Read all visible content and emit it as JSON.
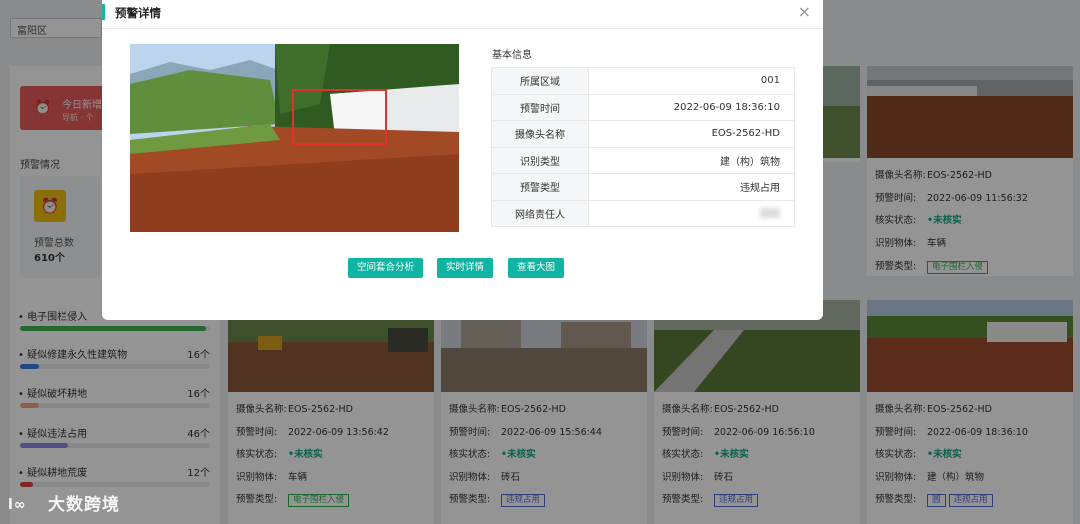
{
  "background": {
    "region_select": "富阳区",
    "today_alert": {
      "title": "今日新增",
      "sub": "导航 · 个"
    },
    "section_title": "预警情况",
    "stat": {
      "label": "预警总数",
      "value": "610个"
    },
    "categories": [
      {
        "name": "• 电子围栏侵入",
        "count": "",
        "fill": 0.98,
        "color": "#3fb44a"
      },
      {
        "name": "• 疑似修建永久性建筑物",
        "count": "16个",
        "fill": 0.1,
        "color": "#3d7be0"
      },
      {
        "name": "• 疑似破坏耕地",
        "count": "16个",
        "fill": 0.1,
        "color": "#f0a080"
      },
      {
        "name": "• 疑似违法占用",
        "count": "46个",
        "fill": 0.25,
        "color": "#8c8ce0"
      },
      {
        "name": "• 疑似耕地荒废",
        "count": "12个",
        "fill": 0.07,
        "color": "#e04040"
      }
    ],
    "top_card": {
      "cam": "EOS-2562-HD",
      "time": "2022-06-09 11:56:32",
      "status": "•未核实",
      "object": "车辆",
      "tags": [
        "电子围栏入侵"
      ]
    },
    "cards": [
      {
        "cam": "EOS-2562-HD",
        "time": "2022-06-09 13:56:42",
        "status": "•未核实",
        "object": "车辆",
        "tags": [
          "电子围栏入侵"
        ],
        "tag_style": "g"
      },
      {
        "cam": "EOS-2562-HD",
        "time": "2022-06-09 15:56:44",
        "status": "•未核实",
        "object": "砖石",
        "tags": [
          "违规占用"
        ],
        "tag_style": "b"
      },
      {
        "cam": "EOS-2562-HD",
        "time": "2022-06-09 16:56:10",
        "status": "•未核实",
        "object": "砖石",
        "tags": [
          "违规占用"
        ],
        "tag_style": "b"
      },
      {
        "cam": "EOS-2562-HD",
        "time": "2022-06-09 18:36:10",
        "status": "•未核实",
        "object": "建（构）筑物",
        "tags": [
          "圆",
          "违规占用"
        ],
        "tag_style": "b"
      }
    ],
    "labels": {
      "cam": "摄像头名称:",
      "time": "预警时间:",
      "status": "核实状态:",
      "object": "识别物体:",
      "type": "预警类型:"
    }
  },
  "modal": {
    "title": "预警详情",
    "close_glyph": "×",
    "info_title": "基本信息",
    "rows": [
      {
        "key": "所属区域",
        "value": "001"
      },
      {
        "key": "预警时间",
        "value": "2022-06-09 18:36:10"
      },
      {
        "key": "摄像头名称",
        "value": "EOS-2562-HD"
      },
      {
        "key": "识别类型",
        "value": "建（构）筑物"
      },
      {
        "key": "预警类型",
        "value": "违规占用"
      },
      {
        "key": "网络责任人",
        "value": ""
      }
    ],
    "buttons": [
      "空间套合分析",
      "实时详情",
      "查看大图"
    ]
  },
  "watermark": {
    "logo": "l∞",
    "text": "大数跨境"
  },
  "colors": {
    "accent": "#10b4a3",
    "alert_red": "#e85a5a",
    "verified_green": "#11a887",
    "detect_box": "#e03030"
  }
}
